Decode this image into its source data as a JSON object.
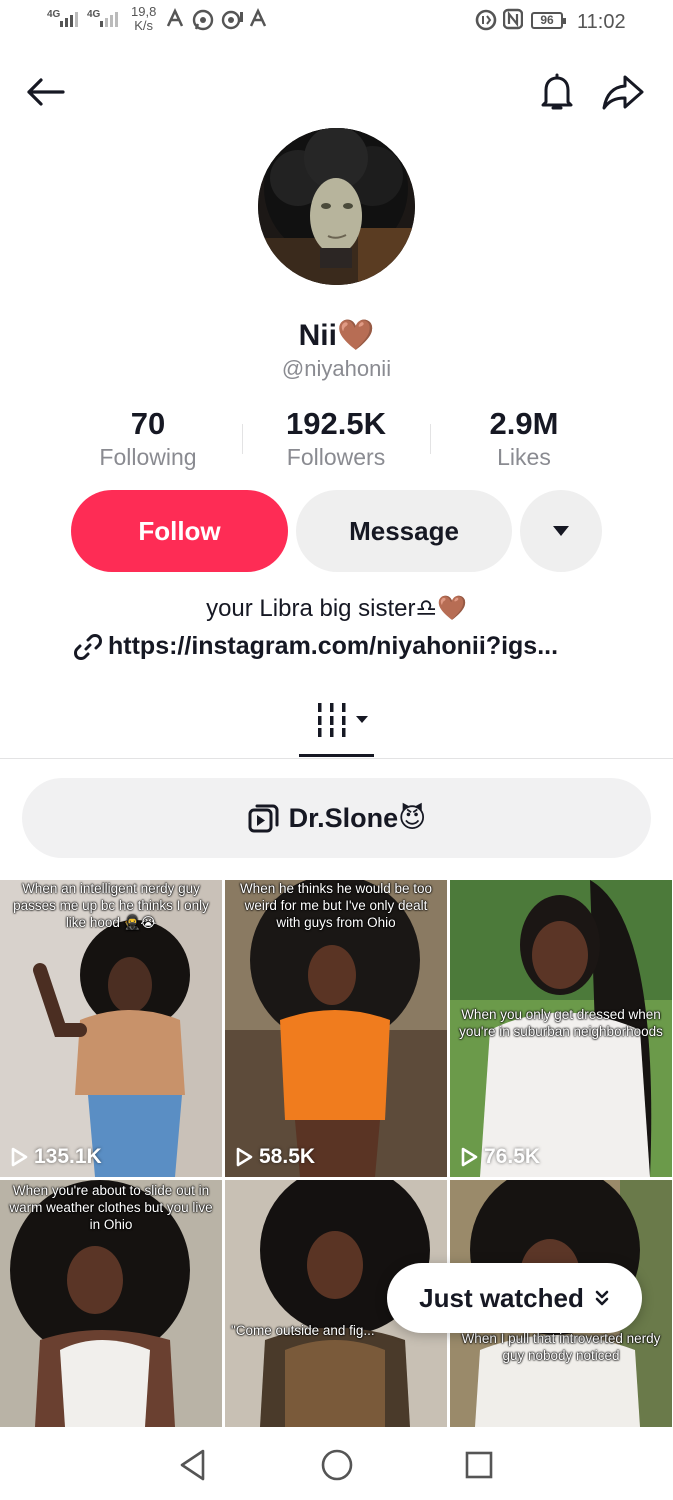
{
  "status_bar": {
    "sig1": "4G",
    "sig2": "4G",
    "speed_value": "19,8",
    "speed_unit": "K/s",
    "battery": "96",
    "time": "11:02"
  },
  "header": {
    "back_icon": "arrow-left-icon",
    "bell_icon": "bell-icon",
    "share_icon": "share-arrow-icon"
  },
  "profile": {
    "name": "Nii🤎",
    "handle": "@niyahonii",
    "stats": [
      {
        "value": "70",
        "label": "Following"
      },
      {
        "value": "192.5K",
        "label": "Followers"
      },
      {
        "value": "2.9M",
        "label": "Likes"
      }
    ],
    "follow_label": "Follow",
    "message_label": "Message",
    "bio": "your Libra big sister♎🤎",
    "link": "https://instagram.com/niyahonii?igs..."
  },
  "playlist": {
    "label": "Dr.Slone😈"
  },
  "videos": [
    {
      "caption": "When an intelligent nerdy guy passes me up bc he thinks I only like hood 🥷😭",
      "views": "135.1K"
    },
    {
      "caption": "When he thinks he would be too weird for me but I've only dealt with guys from Ohio",
      "views": "58.5K"
    },
    {
      "caption": "When you only get dressed when you're in suburban neighborhoods",
      "views": "76.5K"
    },
    {
      "caption": "When you're about to slide out in warm weather clothes but you live in Ohio",
      "views": ""
    },
    {
      "caption": "\"Come outside and fig...",
      "views": ""
    },
    {
      "caption": "When I pull that introverted nerdy guy nobody noticed",
      "views": ""
    }
  ],
  "just_watched": {
    "label": "Just watched"
  },
  "nav": {
    "back": "nav-back-icon",
    "home": "nav-home-icon",
    "recents": "nav-recents-icon"
  },
  "colors": {
    "accent": "#fe2c55",
    "muted_text": "#8a8b91",
    "pill_bg": "#efefef"
  }
}
